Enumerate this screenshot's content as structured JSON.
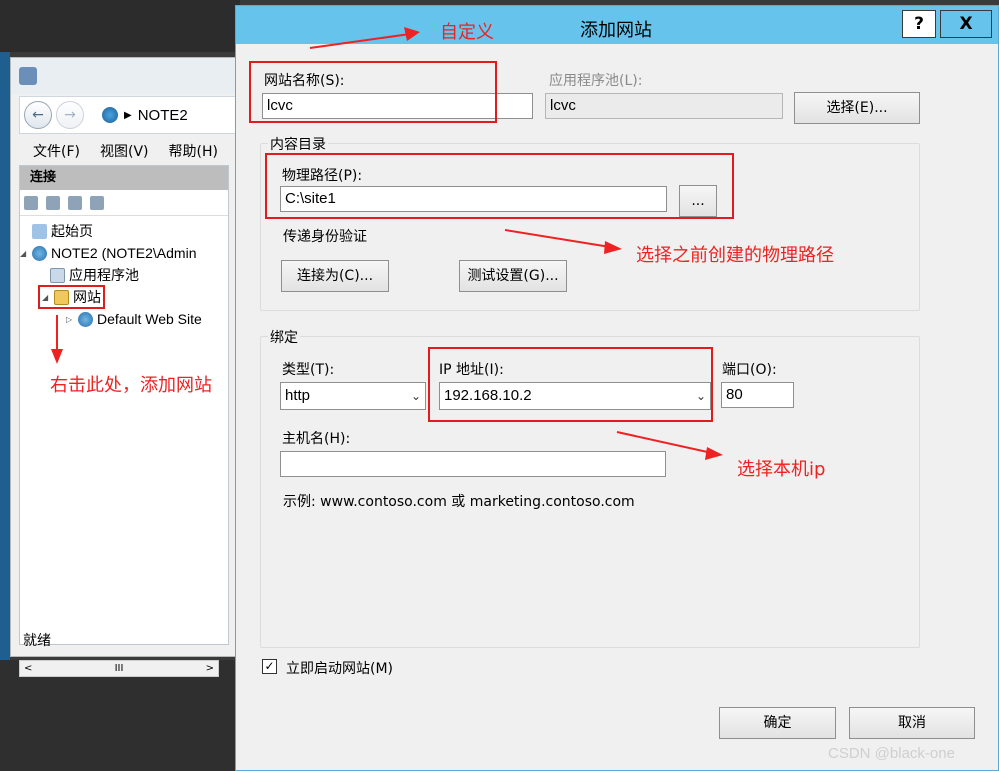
{
  "iis": {
    "address": "NOTE2",
    "menu": [
      "文件(F)",
      "视图(V)",
      "帮助(H)"
    ],
    "connections_header": "连接",
    "tree": {
      "start_page": "起始页",
      "server": "NOTE2 (NOTE2\\Admin",
      "app_pools": "应用程序池",
      "sites": "网站",
      "default_site": "Default Web Site"
    },
    "scroll_thumb": "III",
    "status": "就绪"
  },
  "dialog": {
    "title": "添加网站",
    "help": "?",
    "close": "X",
    "site_name_label": "网站名称(S):",
    "site_name_value": "lcvc",
    "app_pool_label": "应用程序池(L):",
    "app_pool_value": "lcvc",
    "select_button": "选择(E)...",
    "content_group": "内容目录",
    "physical_path_label": "物理路径(P):",
    "physical_path_value": "C:\\site1",
    "browse_button": "...",
    "passthrough_label": "传递身份验证",
    "connect_as_button": "连接为(C)...",
    "test_settings_button": "测试设置(G)...",
    "binding_group": "绑定",
    "type_label": "类型(T):",
    "type_value": "http",
    "ip_label": "IP 地址(I):",
    "ip_value": "192.168.10.2",
    "port_label": "端口(O):",
    "port_value": "80",
    "hostname_label": "主机名(H):",
    "hostname_value": "",
    "example_text": "示例: www.contoso.com 或 marketing.contoso.com",
    "start_immediately_label": "立即启动网站(M)",
    "start_immediately_checked": true,
    "ok_button": "确定",
    "cancel_button": "取消"
  },
  "annotations": {
    "custom": "自定义",
    "choose_path": "选择之前创建的物理路径",
    "right_click": "右击此处，添加网站",
    "choose_ip": "选择本机ip",
    "color": "#ee2222"
  },
  "watermark": "CSDN @black-one"
}
